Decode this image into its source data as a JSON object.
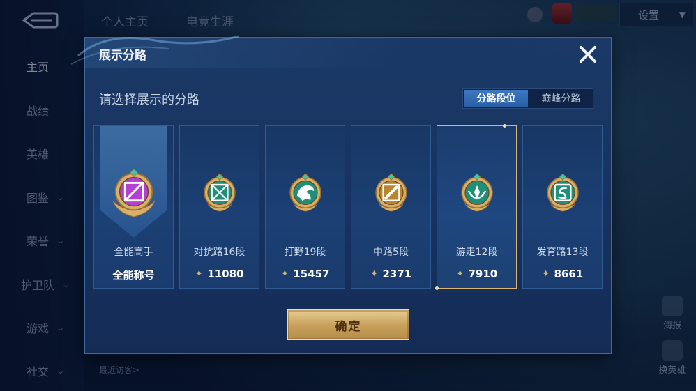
{
  "nav": {
    "items": [
      {
        "label": "主页",
        "active": true,
        "chevron": false
      },
      {
        "label": "战绩",
        "active": false,
        "chevron": false
      },
      {
        "label": "英雄",
        "active": false,
        "chevron": false
      },
      {
        "label": "图鉴",
        "active": false,
        "chevron": true
      },
      {
        "label": "荣誉",
        "active": false,
        "chevron": true
      },
      {
        "label": "护卫队",
        "active": false,
        "chevron": true
      },
      {
        "label": "游戏",
        "active": false,
        "chevron": true
      },
      {
        "label": "社交",
        "active": false,
        "chevron": true
      }
    ]
  },
  "top_tabs": [
    {
      "label": "个人主页",
      "active": true
    },
    {
      "label": "电竞生涯",
      "active": false
    }
  ],
  "settings": {
    "label": "设置"
  },
  "side": {
    "poster": "海报",
    "change_hero": "换英雄"
  },
  "visitors": {
    "label": "最近访客>"
  },
  "dialog": {
    "title": "展示分路",
    "subtitle": "请选择展示的分路",
    "toggle": {
      "options": [
        "分路段位",
        "巅峰分路"
      ],
      "selected_index": 0
    },
    "cards": [
      {
        "name": "全能高手",
        "score": "全能称号",
        "emblem": "all-round-emblem",
        "color": "#b43fd0",
        "selected": false,
        "star": false
      },
      {
        "name": "对抗路16段",
        "score": "11080",
        "emblem": "clash-lane-emblem",
        "color": "#1f8f7a",
        "selected": false,
        "star": true
      },
      {
        "name": "打野19段",
        "score": "15457",
        "emblem": "jungle-emblem",
        "color": "#1f8f7a",
        "selected": false,
        "star": true
      },
      {
        "name": "中路5段",
        "score": "2371",
        "emblem": "mid-lane-emblem",
        "color": "#b7862f",
        "selected": false,
        "star": true
      },
      {
        "name": "游走12段",
        "score": "7910",
        "emblem": "roam-emblem",
        "color": "#1f8f7a",
        "selected": true,
        "star": true
      },
      {
        "name": "发育路13段",
        "score": "8661",
        "emblem": "farm-lane-emblem",
        "color": "#1f8f7a",
        "selected": false,
        "star": true
      }
    ],
    "confirm_label": "确定"
  },
  "colors": {
    "accent_gold": "#d9b678",
    "dialog_bg": "#173260",
    "toggle_selected": "#2a5fa6"
  }
}
